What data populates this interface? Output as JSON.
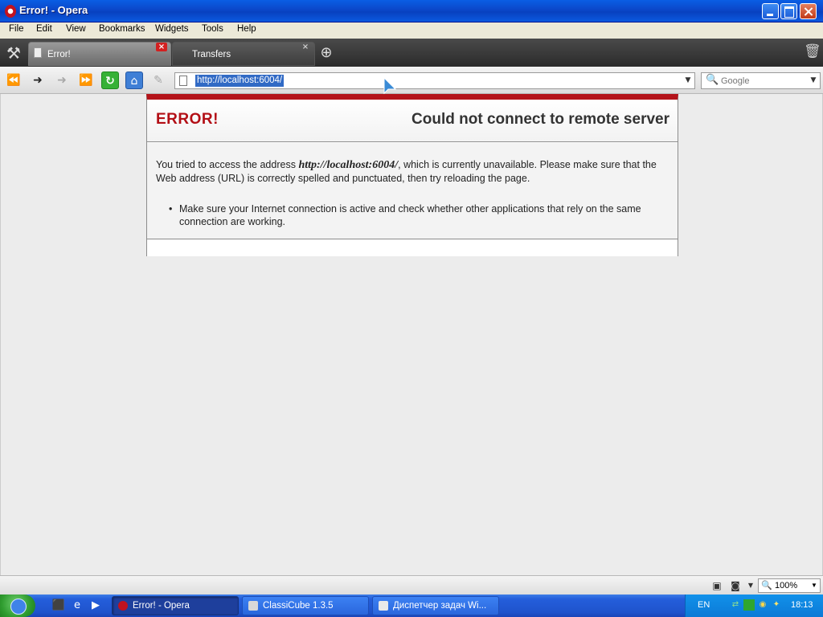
{
  "window": {
    "title": "Error! - Opera"
  },
  "menu": {
    "items": [
      "File",
      "Edit",
      "View",
      "Bookmarks",
      "Widgets",
      "Tools",
      "Help"
    ]
  },
  "tabs": [
    {
      "label": "Error!",
      "active": true,
      "close": "×"
    },
    {
      "label": "Transfers",
      "active": false,
      "close": "×"
    }
  ],
  "icons": {
    "tools": "tools-icon",
    "new_tab": "plus-icon",
    "trash": "trash-icon",
    "rewind": "rewind-icon",
    "back": "back-arrow-icon",
    "forward": "forward-arrow-icon",
    "fast_forward": "fast-forward-icon",
    "reload": "reload-icon",
    "home": "home-icon",
    "edit": "pen-icon",
    "search": "magnifier-icon"
  },
  "navbar": {
    "address_value": "http://localhost:6004/",
    "search_placeholder": "Google"
  },
  "page": {
    "error_label": "ERROR!",
    "error_title": "Could not connect to remote server",
    "msg_prefix": "You tried to access the address ",
    "msg_address": "http://localhost:6004/",
    "msg_suffix": ", which is currently unavailable. Please make sure that the Web address (URL) is correctly spelled and punctuated, then try reloading the page.",
    "tip": "Make sure your Internet connection is active and check whether other applications that rely on the same connection are working."
  },
  "statusbar": {
    "zoom": "100%"
  },
  "taskbar": {
    "tasks": [
      {
        "label": "Error! - Opera",
        "active": true
      },
      {
        "label": "ClassiCube 1.3.5",
        "active": false
      },
      {
        "label": "Диспетчер задач Wi...",
        "active": false
      }
    ],
    "language": "EN",
    "clock": "18:13"
  },
  "colors": {
    "error_red": "#b30f16",
    "title_bar_blue": "#0b47c9",
    "taskbar_blue": "#245edb"
  }
}
